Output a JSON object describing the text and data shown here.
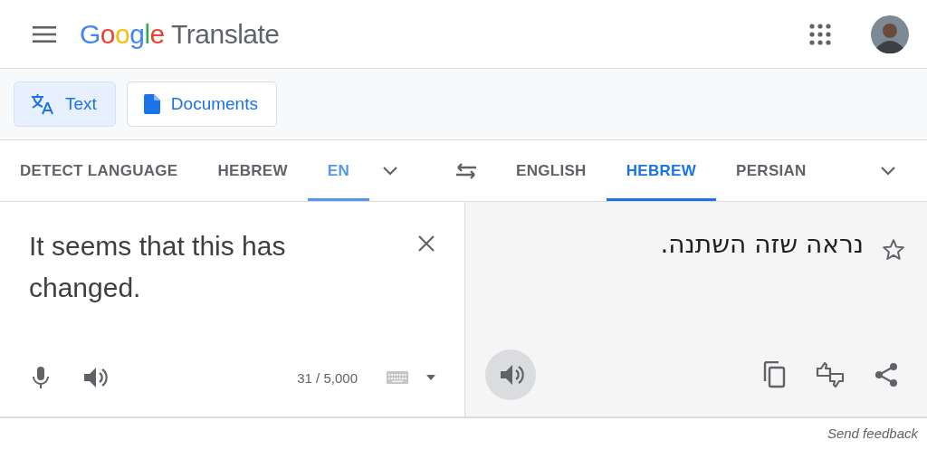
{
  "header": {
    "logo_word": "Google",
    "product": "Translate"
  },
  "modes": [
    {
      "label": "Text",
      "kind": "text",
      "selected": true
    },
    {
      "label": "Documents",
      "kind": "documents",
      "selected": false
    }
  ],
  "source_languages": [
    {
      "label": "DETECT LANGUAGE",
      "selected": false
    },
    {
      "label": "HEBREW",
      "selected": false
    },
    {
      "label": "EN",
      "selected": true
    }
  ],
  "target_languages": [
    {
      "label": "ENGLISH",
      "selected": false
    },
    {
      "label": "HEBREW",
      "selected": true
    },
    {
      "label": "PERSIAN",
      "selected": false
    }
  ],
  "source": {
    "value": "It seems that this has changed.",
    "char_count": "31 / 5,000"
  },
  "target": {
    "text": "נראה שזה השתנה.",
    "saved": false
  },
  "footer": {
    "feedback": "Send feedback"
  }
}
